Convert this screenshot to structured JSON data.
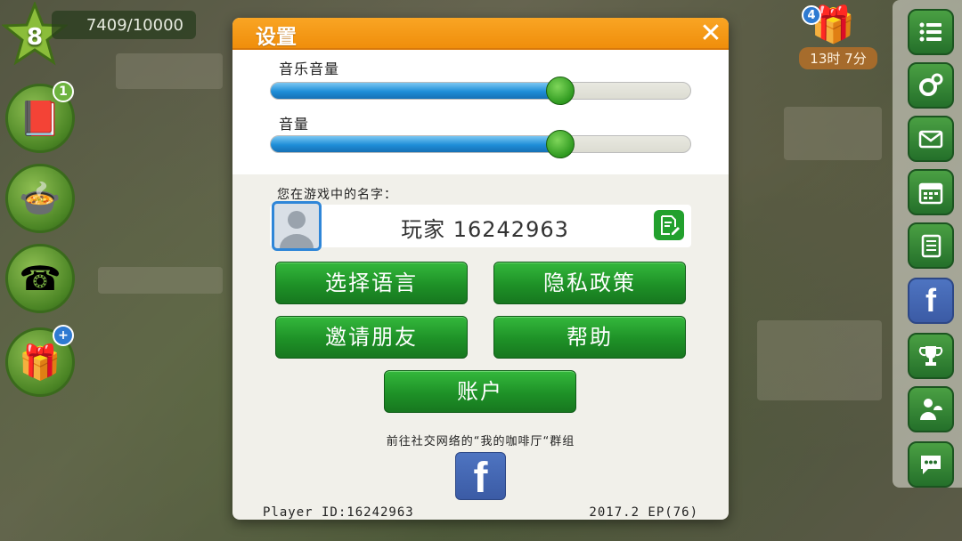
{
  "hud": {
    "level": "8",
    "xp": "7409/10000",
    "left_buttons": [
      {
        "name": "recipe-book",
        "icon": "📕",
        "badge": "1"
      },
      {
        "name": "cooking-pot",
        "icon": "🍲",
        "badge": ""
      },
      {
        "name": "telephone",
        "icon": "☎",
        "badge": ""
      },
      {
        "name": "gift-shop",
        "icon": "🎁",
        "badge": "+"
      }
    ],
    "gift": {
      "count": "4",
      "timer": "13时 7分"
    }
  },
  "sidebar": {
    "items": [
      {
        "name": "menu-list",
        "icon": "list-icon"
      },
      {
        "name": "settings",
        "icon": "gear-icon"
      },
      {
        "name": "mail",
        "icon": "mail-icon"
      },
      {
        "name": "calendar",
        "icon": "calendar-icon"
      },
      {
        "name": "notes",
        "icon": "notepad-icon"
      },
      {
        "name": "facebook",
        "icon": "facebook-icon"
      },
      {
        "name": "trophy",
        "icon": "trophy-icon"
      },
      {
        "name": "staff",
        "icon": "waiter-icon"
      },
      {
        "name": "chat",
        "icon": "chat-icon"
      }
    ]
  },
  "dialog": {
    "title": "设置",
    "music_label": "音乐音量",
    "music_level": 0.69,
    "sound_label": "音量",
    "sound_level": 0.69,
    "name_label": "您在游戏中的名字：",
    "player_name": "玩家 16242963",
    "buttons": {
      "language": "选择语言",
      "privacy": "隐私政策",
      "invite": "邀请朋友",
      "help": "帮助",
      "account": "账户"
    },
    "social_text": "前往社交网络的“我的咖啡厅“群组",
    "facebook_glyph": "f",
    "player_id": "Player ID:16242963",
    "version": "2017.2 EP(76)"
  },
  "colors": {
    "header_orange": "#f59a18",
    "button_green": "#1e9127",
    "slider_blue": "#1f8ed8",
    "facebook_blue": "#3b5ba5"
  }
}
